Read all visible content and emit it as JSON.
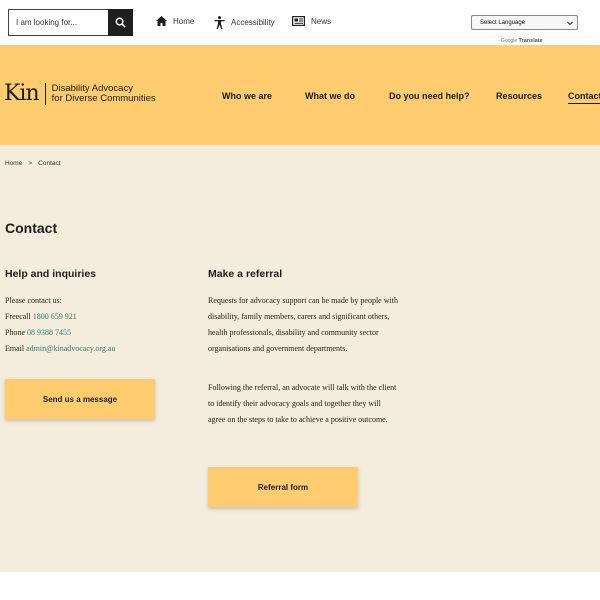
{
  "search": {
    "placeholder": "I am looking for..."
  },
  "utility_links": [
    {
      "label": "Home",
      "icon": "home-icon"
    },
    {
      "label": "Accessibility",
      "icon": "accessibility-icon"
    },
    {
      "label": "News",
      "icon": "news-icon"
    }
  ],
  "language": {
    "selected": "Select Language",
    "powered_by": "Google",
    "translate": "Translate"
  },
  "logo": {
    "mark": "Kin",
    "line1": "Disability Advocacy",
    "line2": "for Diverse Communities"
  },
  "nav": [
    {
      "label": "Who we are"
    },
    {
      "label": "What we do"
    },
    {
      "label": "Do you need help?"
    },
    {
      "label": "Resources"
    },
    {
      "label": "Contact"
    }
  ],
  "breadcrumb": {
    "home": "Home",
    "separator": ">",
    "current": "Contact"
  },
  "page_title": "Contact",
  "help": {
    "heading": "Help and inquiries",
    "intro": "Please contact us:",
    "freecall_label": "Freecall",
    "freecall": "1800 659 921",
    "phone_label": "Phone",
    "phone": "08 9388 7455",
    "email_label": "Email",
    "email": "admin@kinadvocacy.org.au",
    "button": "Send us a message"
  },
  "referral": {
    "heading": "Make a referral",
    "para1": "Requests for advocacy support can be made by people with disability, family members, carers and significant others, health professionals, disability and community sector organisations and government departments.",
    "para2": "Following the referral, an advocate will talk with the client to identify their advocacy goals and together they will agree on the steps to take to achieve a positive outcome.",
    "button": "Referral form"
  },
  "colors": {
    "accent": "#ffcc70",
    "background": "#f4ecdd",
    "link": "#2a7d74",
    "text": "#1c1c1c"
  }
}
